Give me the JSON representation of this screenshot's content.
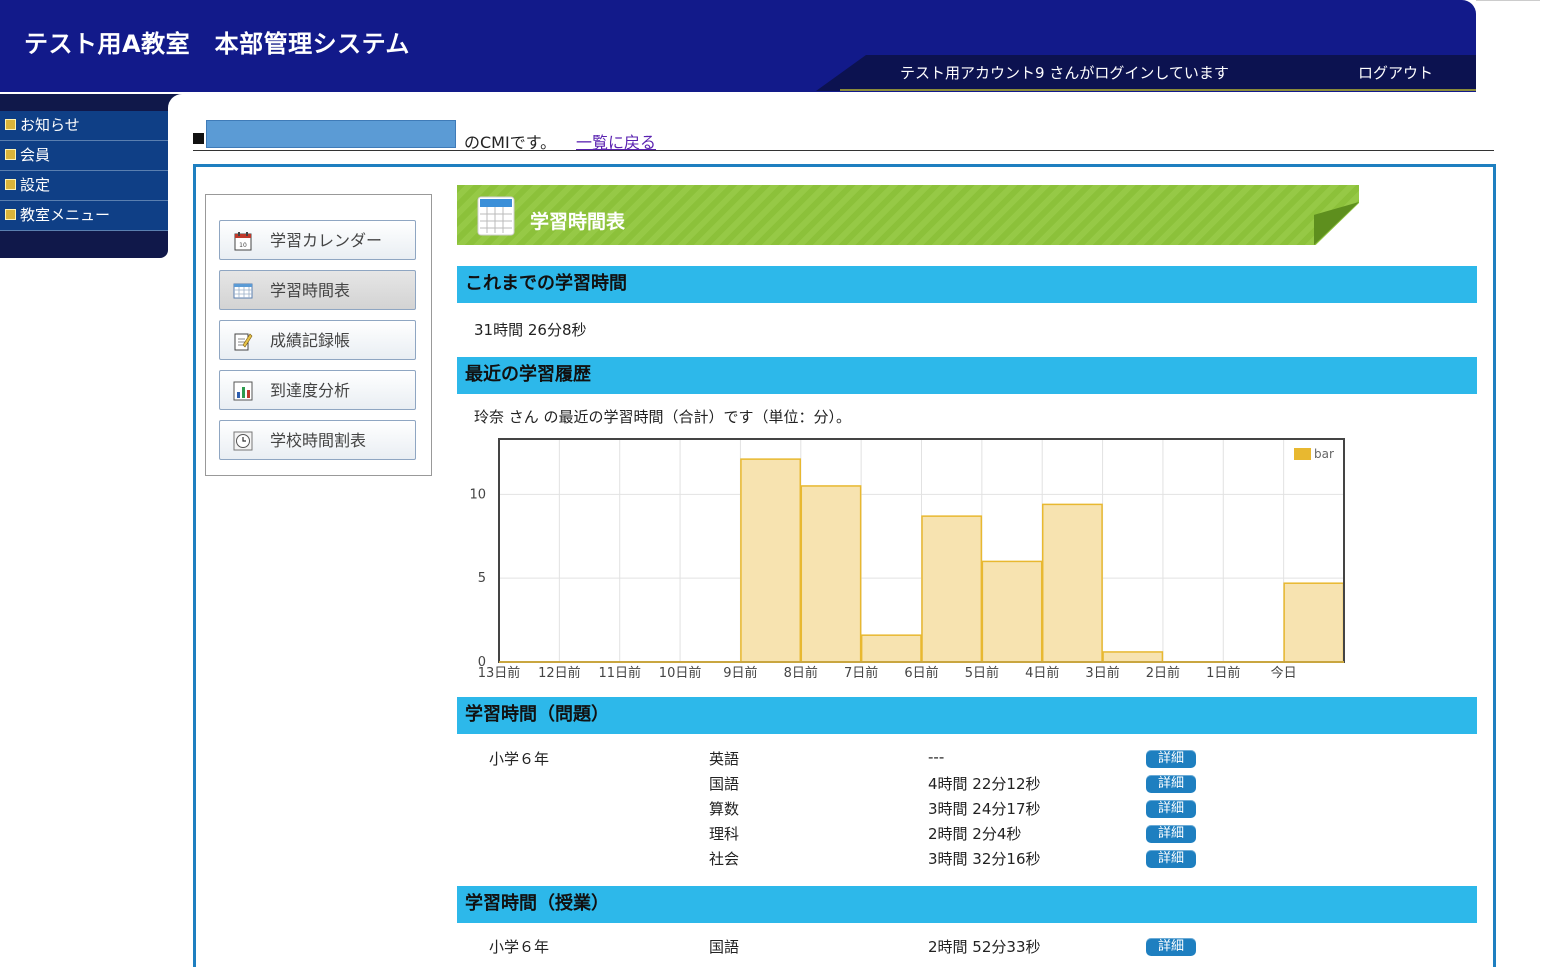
{
  "header": {
    "app_title": "テスト用A教室　本部管理システム",
    "login_message": "テスト用アカウント9 さんがログインしています",
    "logout_label": "ログアウト"
  },
  "nav": {
    "items": [
      {
        "label": "お知らせ"
      },
      {
        "label": "会員"
      },
      {
        "label": "設定"
      },
      {
        "label": "教室メニュー"
      }
    ]
  },
  "breadcrumb": {
    "suffix_text": "のCMIです。",
    "back_link": "一覧に戻る"
  },
  "side_menu": {
    "items": [
      {
        "label": "学習カレンダー",
        "icon": "calendar-icon"
      },
      {
        "label": "学習時間表",
        "icon": "timetable-icon"
      },
      {
        "label": "成績記録帳",
        "icon": "notebook-icon"
      },
      {
        "label": "到達度分析",
        "icon": "bar-chart-icon"
      },
      {
        "label": "学校時間割表",
        "icon": "clock-icon"
      }
    ]
  },
  "banner": {
    "title": "学習時間表"
  },
  "sections": {
    "total_title": "これまでの学習時間",
    "total_value": "31時間 26分8秒",
    "recent_title": "最近の学習履歴",
    "recent_note": "玲奈 さん の最近の学習時間（合計）です（単位：分）。",
    "problems_title": "学習時間（問題）",
    "lessons_title": "学習時間（授業）"
  },
  "chart_data": {
    "type": "bar",
    "categories": [
      "13日前",
      "12日前",
      "11日前",
      "10日前",
      "9日前",
      "8日前",
      "7日前",
      "6日前",
      "5日前",
      "4日前",
      "3日前",
      "2日前",
      "1日前",
      "今日"
    ],
    "series": [
      {
        "name": "bar",
        "values": [
          0,
          0,
          0,
          0,
          12.1,
          10.5,
          1.6,
          8.7,
          6.0,
          9.4,
          0.6,
          0,
          0,
          4.7
        ]
      }
    ],
    "ylim": [
      0,
      13.3
    ],
    "yticks": [
      0,
      5,
      10
    ],
    "legend": "top-right",
    "grid": true,
    "colors": {
      "fill": "#f7e3b0",
      "stroke": "#e8b830"
    }
  },
  "problems_table": {
    "grade": "小学６年",
    "detail_label": "詳細",
    "rows": [
      {
        "subject": "英語",
        "time": "---"
      },
      {
        "subject": "国語",
        "time": "4時間 22分12秒"
      },
      {
        "subject": "算数",
        "time": "3時間 24分17秒"
      },
      {
        "subject": "理科",
        "time": "2時間 2分4秒"
      },
      {
        "subject": "社会",
        "time": "3時間 32分16秒"
      }
    ]
  },
  "lessons_table": {
    "grade": "小学６年",
    "detail_label": "詳細",
    "rows": [
      {
        "subject": "国語",
        "time": "2時間 52分33秒"
      }
    ]
  },
  "colors": {
    "header_bg": "#121a8a",
    "section_bar": "#2db8ea",
    "banner_green": "#8cc13a",
    "detail_button": "#1e7fc0"
  }
}
